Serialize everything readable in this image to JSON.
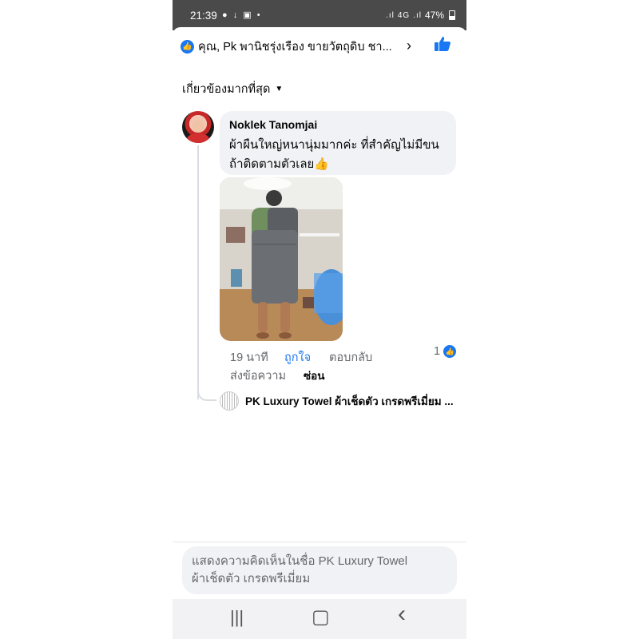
{
  "status_bar": {
    "time": "21:39",
    "left_icons": "● ↓ ▣ •",
    "network": "4G",
    "battery": "47%"
  },
  "header": {
    "text": "คุณ, Pk พานิชรุ่งเรือง ขายวัตถุดิบ ชา...",
    "chevron": "›"
  },
  "filter": {
    "label": "เกี่ยวข้องมากที่สุด",
    "caret": "⌄"
  },
  "comment": {
    "author": "Noklek Tanomjai",
    "text": "ผ้าผืนใหญ่หนานุ่มมากค่ะ ที่สำคัญไม่มีขนถ้าติดตามตัวเลย👍",
    "time": "19 นาที",
    "like_label": "ถูกใจ",
    "reply_label": "ตอบกลับ",
    "send_label": "ส่งข้อความ",
    "hide_label": "ซ่อน",
    "reaction_count": "1"
  },
  "reply": {
    "text": "PK Luxury Towel ผ้าเช็ดตัว เกรดพรีเมี่ยม ..."
  },
  "composer": {
    "placeholder": "แสดงความคิดเห็นในชื่อ PK Luxury Towel ผ้าเช็ดตัว เกรดพรีเมี่ยม"
  },
  "nav": {
    "recents": "|||",
    "home": "▢",
    "back": "‹"
  },
  "colors": {
    "accent": "#1877f2",
    "bubble": "#f0f2f5",
    "status_bar": "#4a4a4a"
  }
}
